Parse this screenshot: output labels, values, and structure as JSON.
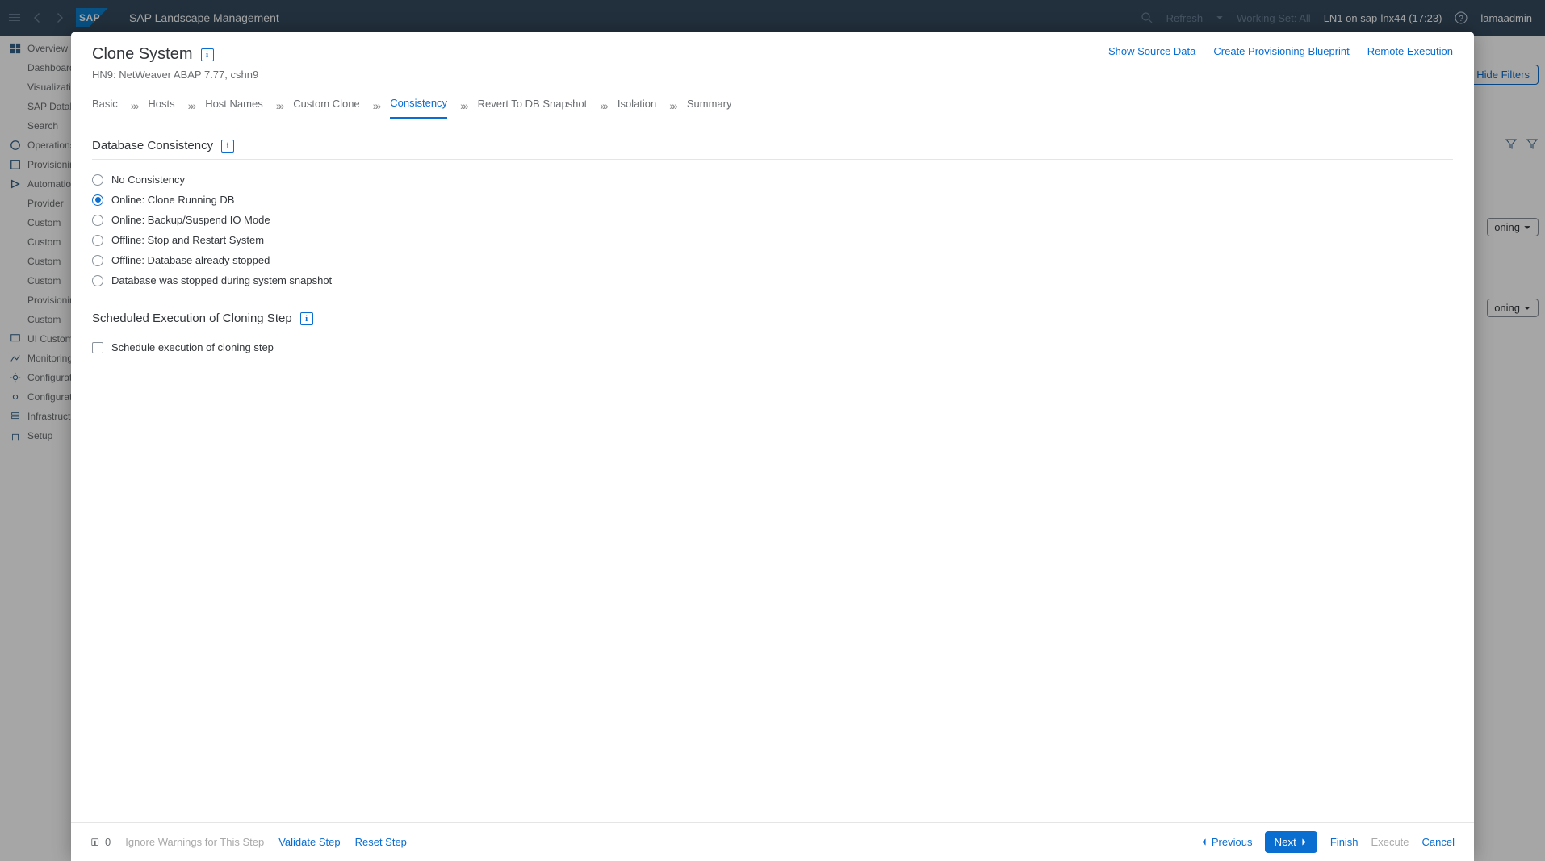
{
  "shell": {
    "app_title": "SAP Landscape Management",
    "logo_text": "SAP",
    "refresh": "Refresh",
    "working_set": "Working Set: All",
    "system_info": "LN1 on sap-lnx44 (17:23)",
    "user": "lamaadmin"
  },
  "sidebar": {
    "items": [
      "Overview",
      "Dashboard",
      "Visualization",
      "SAP Database",
      "Search",
      "Operations",
      "Provisioning",
      "Automation",
      "Provider",
      "Custom",
      "Custom",
      "Custom",
      "Custom",
      "Provisioning",
      "Custom",
      "UI Customization",
      "Monitoring",
      "Configuration",
      "Configuration",
      "Infrastructure",
      "Setup"
    ]
  },
  "bg": {
    "hide_filters": "Hide Filters",
    "dropdown_suffix": "oning"
  },
  "dialog": {
    "title": "Clone System",
    "subtitle": "HN9: NetWeaver ABAP 7.77, cshn9",
    "actions": {
      "show_source": "Show Source Data",
      "create_blueprint": "Create Provisioning Blueprint",
      "remote_exec": "Remote Execution"
    },
    "tabs": {
      "basic": "Basic",
      "hosts": "Hosts",
      "host_names": "Host Names",
      "custom_clone": "Custom Clone",
      "consistency": "Consistency",
      "revert": "Revert To DB Snapshot",
      "isolation": "Isolation",
      "summary": "Summary"
    },
    "section1": "Database Consistency",
    "radios": {
      "r0": "No Consistency",
      "r1": "Online: Clone Running DB",
      "r2": "Online: Backup/Suspend IO Mode",
      "r3": "Offline: Stop and Restart System",
      "r4": "Offline: Database already stopped",
      "r5": "Database was stopped during system snapshot"
    },
    "section2": "Scheduled Execution of Cloning Step",
    "checkbox_label": "Schedule execution of cloning step",
    "footer": {
      "count": "0",
      "ignore": "Ignore Warnings for This Step",
      "validate": "Validate Step",
      "reset": "Reset Step",
      "previous": "Previous",
      "next": "Next",
      "finish": "Finish",
      "execute": "Execute",
      "cancel": "Cancel"
    }
  }
}
